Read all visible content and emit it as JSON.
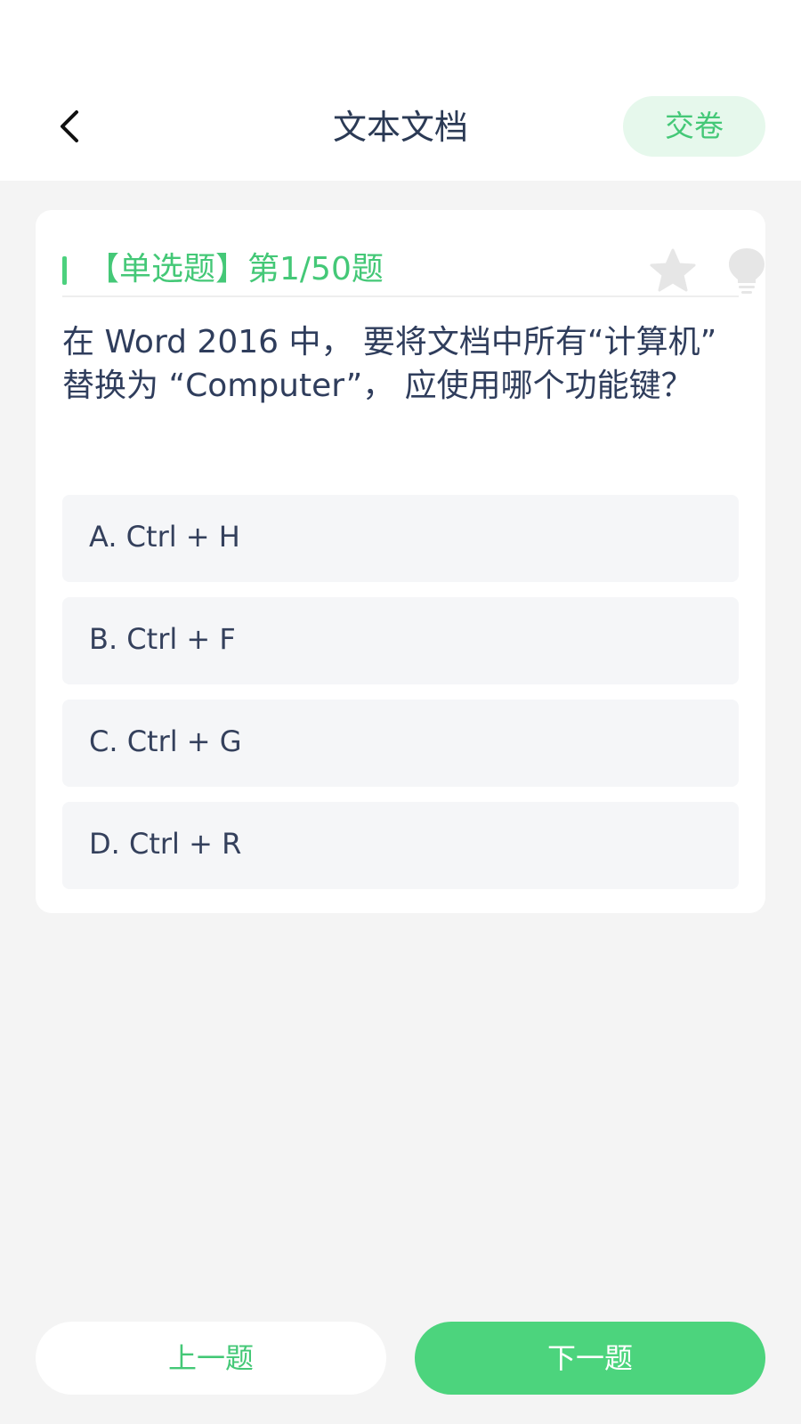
{
  "header": {
    "title": "文本文档",
    "submit_label": "交卷"
  },
  "question": {
    "type_label": "【单选题】",
    "progress_label": "第1/50题",
    "text": "在 Word 2016 中， 要将文档中所有“计算机” 替换为 “Computer”， 应使用哪个功能键？",
    "options": [
      {
        "label": "A. Ctrl + H"
      },
      {
        "label": "B. Ctrl + F"
      },
      {
        "label": "C. Ctrl + G"
      },
      {
        "label": "D. Ctrl + R"
      }
    ]
  },
  "footer": {
    "prev_label": "上一题",
    "next_label": "下一题"
  },
  "icons": {
    "back": "chevron-left-icon",
    "favorite": "star-icon",
    "hint": "lightbulb-icon"
  },
  "colors": {
    "accent": "#4cd47d",
    "accent_text": "#44c877",
    "title_text": "#2b3a55",
    "background": "#f4f4f4",
    "option_bg": "#f5f6f8",
    "icon_gray": "#e6e6e6"
  }
}
